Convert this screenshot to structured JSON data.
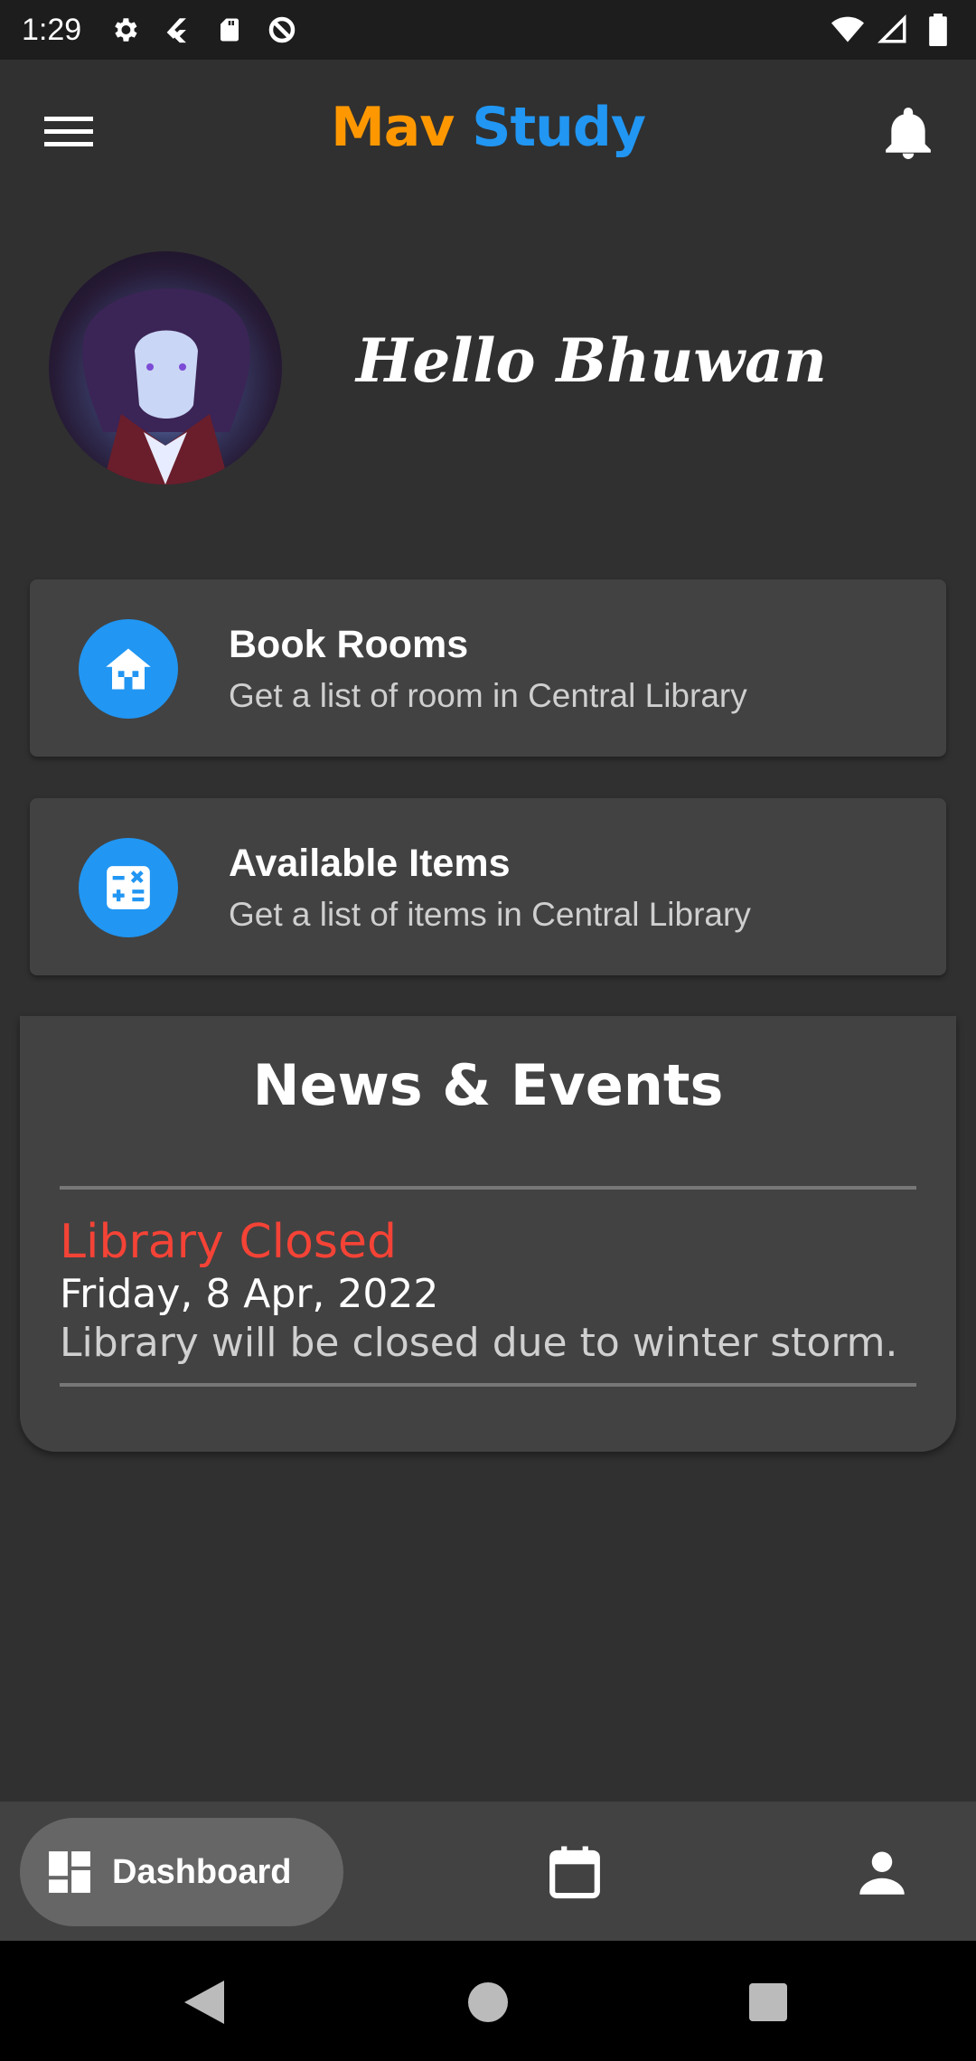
{
  "status_bar": {
    "time": "1:29",
    "left_icons": [
      "settings-icon",
      "flutter-icon",
      "sd-card-icon",
      "data-saver-icon"
    ],
    "right_icons": [
      "wifi-icon",
      "cell-signal-icon",
      "battery-icon"
    ]
  },
  "app_bar": {
    "title_part1": "Mav",
    "title_part2": "Study",
    "title_part1_color": "#ff9800",
    "title_part2_color": "#2196f3",
    "menu_icon": "menu-icon",
    "bell_icon": "bell-icon"
  },
  "greeting": {
    "text": "Hello Bhuwan"
  },
  "cards": [
    {
      "title": "Book Rooms",
      "subtitle": "Get a list of room in Central Library",
      "icon": "house-icon",
      "icon_bg": "#2196f3"
    },
    {
      "title": "Available Items",
      "subtitle": "Get a list of items in Central Library",
      "icon": "calculator-icon",
      "icon_bg": "#2196f3"
    }
  ],
  "news": {
    "heading": "News & Events",
    "events": [
      {
        "title": "Library Closed",
        "date": "Friday, 8 Apr, 2022",
        "description": "Library will be closed due to winter storm.",
        "title_color": "#f44336"
      }
    ]
  },
  "bottom_nav": {
    "dashboard_label": "Dashboard",
    "dashboard_icon": "dashboard-icon",
    "calendar_icon": "calendar-icon",
    "profile_icon": "person-icon"
  },
  "system_nav": {
    "back_icon": "back-icon",
    "home_icon": "home-icon",
    "recents_icon": "recents-icon"
  }
}
